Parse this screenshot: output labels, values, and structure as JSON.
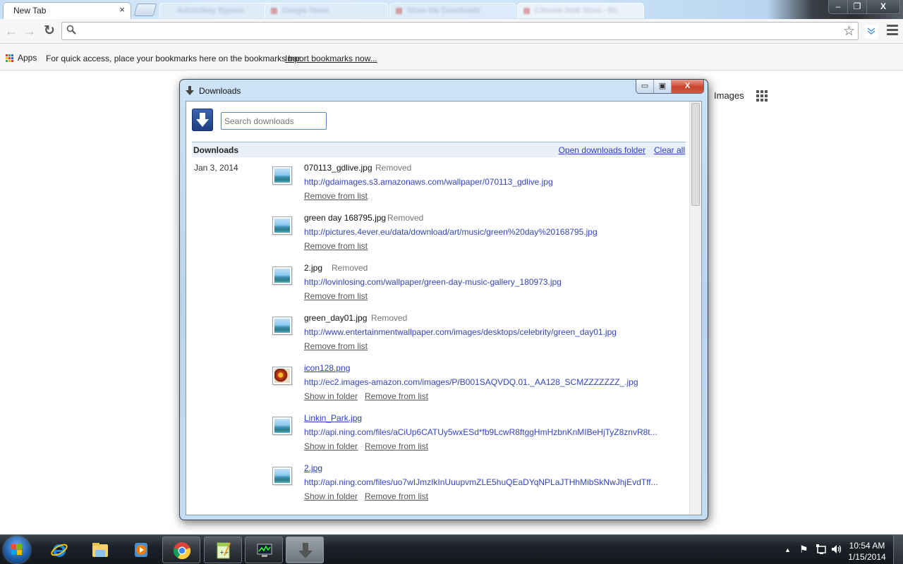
{
  "browser": {
    "tabs": [
      {
        "title": "New Tab",
        "active": true,
        "close_glyph": "×"
      },
      {
        "title": "Autohotkey Bypass",
        "active": false
      },
      {
        "title": "Google News",
        "active": false
      },
      {
        "title": "Show Me Downloads",
        "active": false
      },
      {
        "title": "Chrome Web Store - Bo",
        "active": false
      }
    ],
    "window_controls": {
      "minimize": "–",
      "restore": "❐",
      "close": "X"
    },
    "toolbar": {
      "back_icon": "←",
      "forward_icon": "→",
      "reload_icon": "↻",
      "omnibox_value": "",
      "omnibox_icon": "⚲",
      "star_icon": "☆",
      "extension_icon": "≚"
    },
    "bookmarks_bar": {
      "apps_label": "Apps",
      "hint": "For quick access, place your bookmarks here on the bookmarks bar.",
      "import_link": "Import bookmarks now..."
    },
    "ntp": {
      "images_link": "Images"
    }
  },
  "downloads_window": {
    "title": "Downloads",
    "title_icon": "⬇",
    "controls": {
      "minimize": "▭",
      "maximize": "▣",
      "close": "X"
    },
    "search_placeholder": "Search downloads",
    "search_value": "",
    "header": {
      "title": "Downloads",
      "open_folder": "Open downloads folder",
      "clear_all": "Clear all"
    },
    "date_group": "Jan 3, 2014",
    "items": [
      {
        "filename": "070113_gdlive.jpg",
        "status": "Removed",
        "url": "http://gdaimages.s3.amazonaws.com/wallpaper/070113_gdlive.jpg",
        "actions": [
          "Remove from list"
        ],
        "icon": "image-file-icon"
      },
      {
        "filename": "green day 168795.jpg",
        "status": "Removed",
        "url": "http://pictures.4ever.eu/data/download/art/music/green%20day%20168795.jpg",
        "actions": [
          "Remove from list"
        ],
        "icon": "image-file-icon"
      },
      {
        "filename": "2.jpg",
        "status": "Removed",
        "url": "http://lovinlosing.com/wallpaper/green-day-music-gallery_180973.jpg",
        "actions": [
          "Remove from list"
        ],
        "icon": "image-file-icon"
      },
      {
        "filename": "green_day01.jpg",
        "status": "Removed",
        "url": "http://www.entertainmentwallpaper.com/images/desktops/celebrity/green_day01.jpg",
        "actions": [
          "Remove from list"
        ],
        "icon": "image-file-icon"
      },
      {
        "filename": "icon128.png",
        "status": "",
        "url": "http://ec2.images-amazon.com/images/P/B001SAQVDQ.01._AA128_SCMZZZZZZZ_.jpg",
        "actions": [
          "Show in folder",
          "Remove from list"
        ],
        "icon": "flower-thumbnail-icon"
      },
      {
        "filename": "Linkin_Park.jpg",
        "status": "",
        "url": "http://api.ning.com/files/aCiUp6CATUy5wxESd*fb9LcwR8ftggHmHzbnKnMIBeHjTyZ8znvR8t...",
        "actions": [
          "Show in folder",
          "Remove from list"
        ],
        "icon": "image-file-icon"
      },
      {
        "filename": "2.jpg",
        "status": "",
        "url": "http://api.ning.com/files/uo7wIJmzIkInUuupvmZLE5huQEaDYqNPLaJTHhMibSkNwJhjEvdTff...",
        "actions": [
          "Show in folder",
          "Remove from list"
        ],
        "icon": "image-file-icon"
      }
    ]
  },
  "taskbar": {
    "clock_time": "10:54 AM",
    "clock_date": "1/15/2014",
    "tray_arrow": "▲",
    "tray_icons": {
      "flag": "⚑",
      "network": "🖧",
      "volume": "🔊"
    }
  }
}
